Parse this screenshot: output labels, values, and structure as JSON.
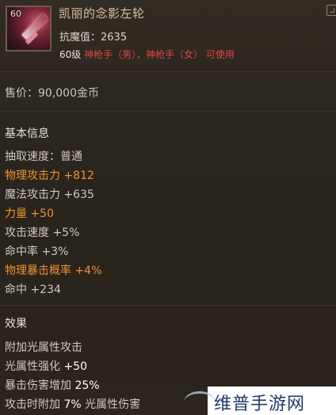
{
  "item": {
    "level_badge": "60",
    "name": "凯丽的念影左轮",
    "resist_label": "抗魔值：2635",
    "req_level": "60级",
    "req_classes": "神枪手（男），神枪手（女） 可使用"
  },
  "price": "售价：90,000金币",
  "basic": {
    "heading": "基本信息",
    "lines": [
      {
        "pre": "抽取速度：普通",
        "val": ""
      },
      {
        "pre": "物理攻击力 ",
        "val": "+812"
      },
      {
        "pre": "魔法攻击力 ",
        "val": "+635"
      },
      {
        "pre": "力量 ",
        "val": "+50"
      },
      {
        "pre": "攻击速度 ",
        "val": "+5%"
      },
      {
        "pre": "命中率 ",
        "val": "+3%"
      },
      {
        "pre": "物理暴击概率 ",
        "val": "+4%"
      },
      {
        "pre": "命中 ",
        "val": "+234"
      }
    ]
  },
  "effects": {
    "heading": "效果",
    "line1": "附加光属性攻击",
    "line2_pre": "光属性强化 ",
    "line2_val": "+50",
    "line3_pre": "暴击伤害增加 ",
    "line3_val": "25%",
    "line4_pre": "攻击时附加 ",
    "line4_val": "7%",
    "line4_post": " 光属性伤害"
  },
  "watermark": "维普手游网",
  "colors": {
    "highlight": "#f0922f",
    "class_red": "#e0444c",
    "title": "#d7bfa6"
  }
}
